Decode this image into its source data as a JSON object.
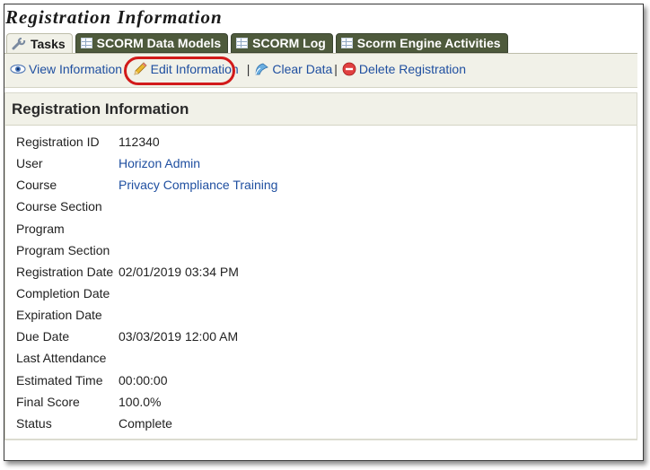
{
  "page": {
    "title": "Registration Information"
  },
  "tabs": [
    {
      "label": "Tasks",
      "icon": "wrench-icon",
      "active": true
    },
    {
      "label": "SCORM Data Models",
      "icon": "table-icon",
      "active": false
    },
    {
      "label": "SCORM Log",
      "icon": "table-icon",
      "active": false
    },
    {
      "label": "Scorm Engine Activities",
      "icon": "table-icon",
      "active": false
    }
  ],
  "toolbar": {
    "view_label": "View Information",
    "edit_label": "Edit Information",
    "clear_label": "Clear Data",
    "delete_label": "Delete Registration",
    "separator": "|"
  },
  "panel": {
    "title": "Registration Information",
    "fields": [
      {
        "label": "Registration ID",
        "value": "112340"
      },
      {
        "label": "User",
        "value": "Horizon Admin"
      },
      {
        "label": "Course",
        "value": "Privacy Compliance Training"
      },
      {
        "label": "Course Section",
        "value": ""
      },
      {
        "label": "Program",
        "value": ""
      },
      {
        "label": "Program Section",
        "value": ""
      },
      {
        "label": "Registration Date",
        "value": "02/01/2019 03:34 PM"
      },
      {
        "label": "Completion Date",
        "value": ""
      },
      {
        "label": "Expiration Date",
        "value": ""
      },
      {
        "label": "Due Date",
        "value": "03/03/2019 12:00 AM"
      },
      {
        "label": "Last Attendance",
        "value": ""
      },
      {
        "label": "Estimated Time",
        "value": "00:00:00"
      },
      {
        "label": "Final Score",
        "value": "100.0%"
      },
      {
        "label": "Status",
        "value": "Complete"
      }
    ]
  },
  "colors": {
    "link": "#1f4fa0",
    "tab_inactive_bg": "#4e5a3c",
    "strip_bg": "#f1f1e8",
    "highlight": "#d21a1a"
  }
}
